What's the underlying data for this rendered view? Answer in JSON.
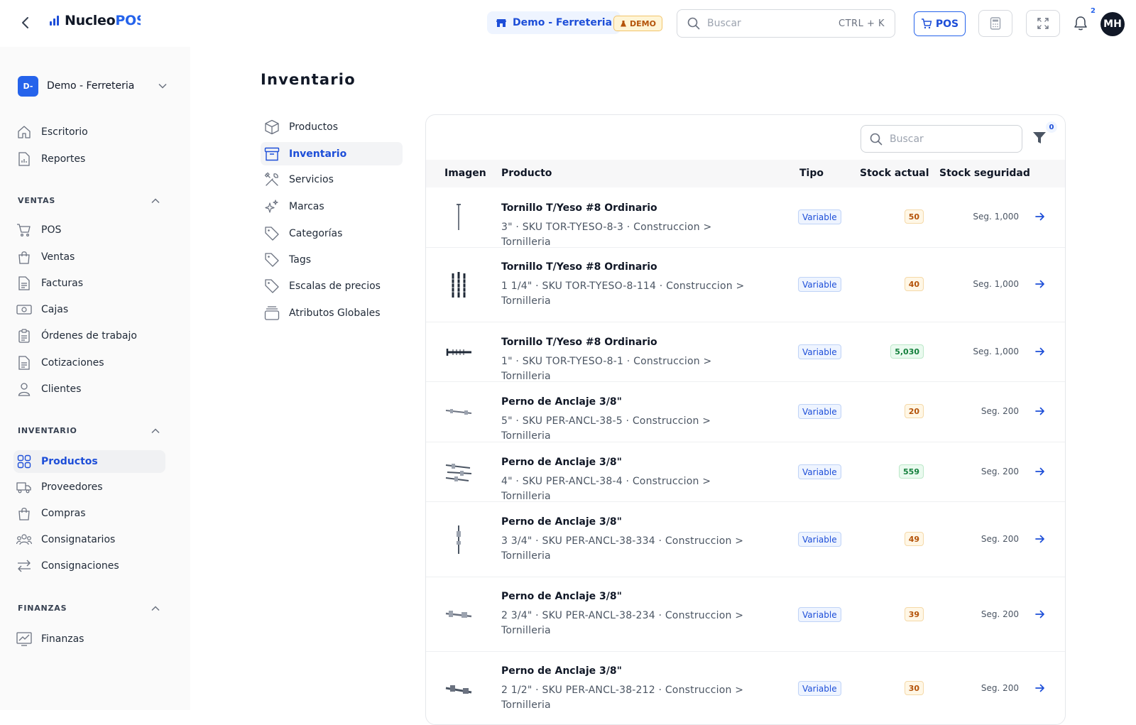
{
  "header": {
    "logo_primary": "Nucleo",
    "logo_secondary": "POS",
    "store_name": "Demo - Ferreteria",
    "demo_badge": "DEMO",
    "search_placeholder": "Buscar",
    "search_shortcut": "CTRL + K",
    "pos_label": "POS",
    "notification_count": "2",
    "avatar_initials": "MH"
  },
  "sidebar": {
    "company_initials": "D-",
    "company_name": "Demo - Ferreteria",
    "top_items": [
      {
        "label": "Escritorio",
        "icon": "home-icon"
      },
      {
        "label": "Reportes",
        "icon": "report-icon"
      }
    ],
    "sections": [
      {
        "title": "VENTAS",
        "items": [
          {
            "label": "POS",
            "icon": "cart-icon"
          },
          {
            "label": "Ventas",
            "icon": "bag-icon"
          },
          {
            "label": "Facturas",
            "icon": "document-icon"
          },
          {
            "label": "Cajas",
            "icon": "cash-register-icon"
          },
          {
            "label": "Órdenes de trabajo",
            "icon": "clipboard-icon"
          },
          {
            "label": "Cotizaciones",
            "icon": "document-icon"
          },
          {
            "label": "Clientes",
            "icon": "user-icon"
          }
        ]
      },
      {
        "title": "INVENTARIO",
        "items": [
          {
            "label": "Productos",
            "icon": "grid-icon",
            "active": true
          },
          {
            "label": "Proveedores",
            "icon": "truck-icon"
          },
          {
            "label": "Compras",
            "icon": "bag-icon"
          },
          {
            "label": "Consignatarios",
            "icon": "users-icon"
          },
          {
            "label": "Consignaciones",
            "icon": "arrows-icon"
          }
        ]
      },
      {
        "title": "FINANZAS",
        "items": [
          {
            "label": "Finanzas",
            "icon": "chart-icon"
          }
        ]
      }
    ]
  },
  "page": {
    "title": "Inventario",
    "subnav": [
      {
        "label": "Productos",
        "icon": "box-icon"
      },
      {
        "label": "Inventario",
        "icon": "archive-icon",
        "active": true
      },
      {
        "label": "Servicios",
        "icon": "tools-icon"
      },
      {
        "label": "Marcas",
        "icon": "sparkles-icon"
      },
      {
        "label": "Categorías",
        "icon": "tag-icon"
      },
      {
        "label": "Tags",
        "icon": "tag-icon"
      },
      {
        "label": "Escalas de precios",
        "icon": "tag-icon"
      },
      {
        "label": "Atributos Globales",
        "icon": "layers-icon"
      }
    ]
  },
  "table": {
    "search_placeholder": "Buscar",
    "filter_count": "0",
    "columns": [
      "Imagen",
      "Producto",
      "Tipo",
      "Stock actual",
      "Stock seguridad"
    ],
    "rows": [
      {
        "name": "Tornillo T/Yeso #8 Ordinario",
        "meta": "3\" · SKU TOR-TYESO-8-3 · Construccion > Tornilleria",
        "tipo": "Variable",
        "stock": "50",
        "stock_state": "warn",
        "seguridad": "Seg. 1,000",
        "image": "single-screw"
      },
      {
        "name": "Tornillo T/Yeso #8 Ordinario",
        "meta": "1 1/4\" · SKU TOR-TYESO-8-114 · Construccion > Tornilleria",
        "tipo": "Variable",
        "stock": "40",
        "stock_state": "warn",
        "seguridad": "Seg. 1,000",
        "image": "screw-group"
      },
      {
        "name": "Tornillo T/Yeso #8 Ordinario",
        "meta": "1\" · SKU TOR-TYESO-8-1 · Construccion > Tornilleria",
        "tipo": "Variable",
        "stock": "5,030",
        "stock_state": "ok",
        "seguridad": "Seg. 1,000",
        "image": "horizontal-screw"
      },
      {
        "name": "Perno de Anclaje 3/8\"",
        "meta": "5\" · SKU PER-ANCL-38-5 · Construccion > Tornilleria",
        "tipo": "Variable",
        "stock": "20",
        "stock_state": "warn",
        "seguridad": "Seg. 200",
        "image": "anchor-bolt"
      },
      {
        "name": "Perno de Anclaje 3/8\"",
        "meta": "4\" · SKU PER-ANCL-38-4 · Construccion > Tornilleria",
        "tipo": "Variable",
        "stock": "559",
        "stock_state": "ok",
        "seguridad": "Seg. 200",
        "image": "anchor-bolts"
      },
      {
        "name": "Perno de Anclaje 3/8\"",
        "meta": "3 3/4\" · SKU PER-ANCL-38-334 · Construccion > Tornilleria",
        "tipo": "Variable",
        "stock": "49",
        "stock_state": "warn",
        "seguridad": "Seg. 200",
        "image": "vertical-bolt"
      },
      {
        "name": "Perno de Anclaje 3/8\"",
        "meta": "2 3/4\" · SKU PER-ANCL-38-234 · Construccion > Tornilleria",
        "tipo": "Variable",
        "stock": "39",
        "stock_state": "warn",
        "seguridad": "Seg. 200",
        "image": "anchor-bolt"
      },
      {
        "name": "Perno de Anclaje 3/8\"",
        "meta": "2 1/2\" · SKU PER-ANCL-38-212 · Construccion > Tornilleria",
        "tipo": "Variable",
        "stock": "30",
        "stock_state": "warn",
        "seguridad": "Seg. 200",
        "image": "anchor-bolt"
      }
    ]
  },
  "colors": {
    "accent": "#2563eb",
    "sidebar_bg": "#fafafa",
    "warn": "#b45309",
    "ok": "#15803d"
  }
}
